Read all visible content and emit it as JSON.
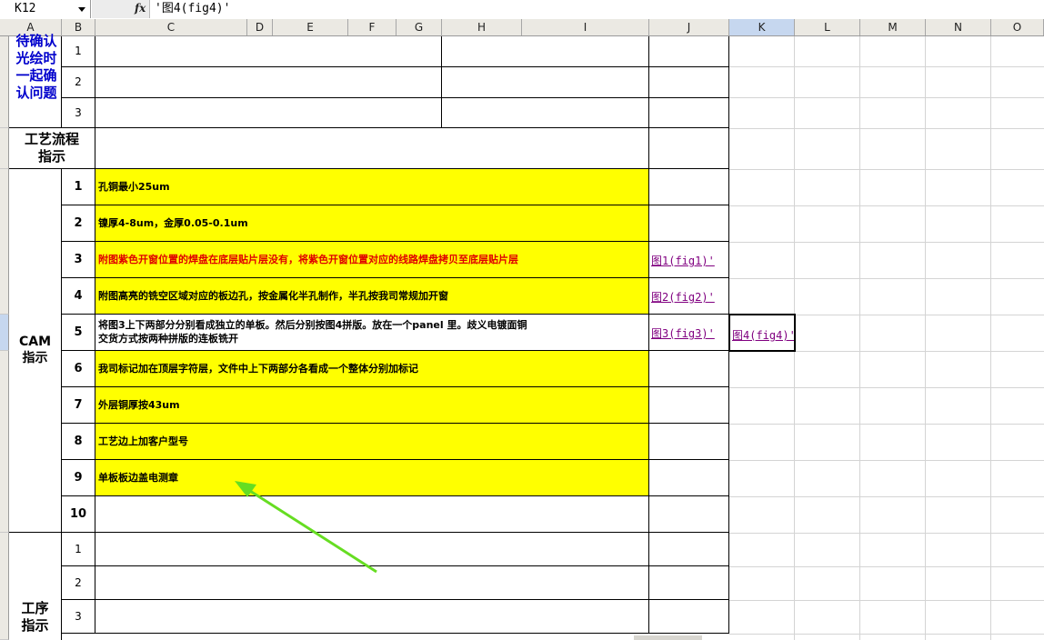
{
  "namebox": "K12",
  "formula": "'图4(fig4)'",
  "columns": [
    "A",
    "B",
    "C",
    "D",
    "E",
    "F",
    "G",
    "H",
    "I",
    "J",
    "K",
    "L",
    "M",
    "N",
    "O"
  ],
  "active_column": "K",
  "confirm_label": "待确认光绘时一起确认问题",
  "confirm_lines": [
    "待确认",
    "光绘时",
    "一起确",
    "认问题"
  ],
  "confirm_nums": [
    "1",
    "2",
    "3"
  ],
  "process_label_lines": [
    "工艺流程",
    "指示"
  ],
  "cam_label_lines": [
    "CAM",
    "指示"
  ],
  "cam_rows": [
    {
      "num": "1",
      "text": "孔铜最小25um",
      "color": "#000000",
      "yellow": true
    },
    {
      "num": "2",
      "text": "镍厚4-8um，金厚0.05-0.1um",
      "color": "#000000",
      "yellow": true
    },
    {
      "num": "3",
      "text": "附图紫色开窗位置的焊盘在底层贴片层没有，将紫色开窗位置对应的线路焊盘拷贝至底层贴片层",
      "color": "#e00000",
      "yellow": true,
      "link": "图1(fig1)'"
    },
    {
      "num": "4",
      "text": "附图高亮的铣空区域对应的板边孔，按金属化半孔制作，半孔按我司常规加开窗",
      "color": "#000000",
      "yellow": true,
      "link": "图2(fig2)'"
    },
    {
      "num": "5",
      "text": "将图3上下两部分分别看成独立的单板。然后分别按图4拼版。放在一个panel 里。歧义电镀面铜交货方式按两种拼版的连板铣开",
      "text_lines": [
        "将图3上下两部分分别看成独立的单板。然后分别按图4拼版。放在一个panel 里。歧义电镀面铜",
        "交货方式按两种拼版的连板铣开"
      ],
      "color": "#000000",
      "yellow": false,
      "link": "图3(fig3)'",
      "link2": "图4(fig4)'"
    },
    {
      "num": "6",
      "text": "我司标记加在顶层字符层，文件中上下两部分各看成一个整体分别加标记",
      "color": "#000000",
      "yellow": true
    },
    {
      "num": "7",
      "text": "外层铜厚按43um",
      "color": "#000000",
      "yellow": true
    },
    {
      "num": "8",
      "text": "工艺边上加客户型号",
      "color": "#000000",
      "yellow": true
    },
    {
      "num": "9",
      "text": "单板板边盖电测章",
      "color": "#000000",
      "yellow": true
    },
    {
      "num": "10",
      "text": "",
      "color": "#000000",
      "yellow": false
    }
  ],
  "process_rows": [
    "1",
    "2",
    "3"
  ],
  "process_steps_label_lines": [
    "工序",
    "指示"
  ],
  "colors": {
    "highlight": "#ffff00",
    "arrow": "#66dd22",
    "link": "#800080",
    "red": "#e00000",
    "blue": "#0000cc"
  }
}
